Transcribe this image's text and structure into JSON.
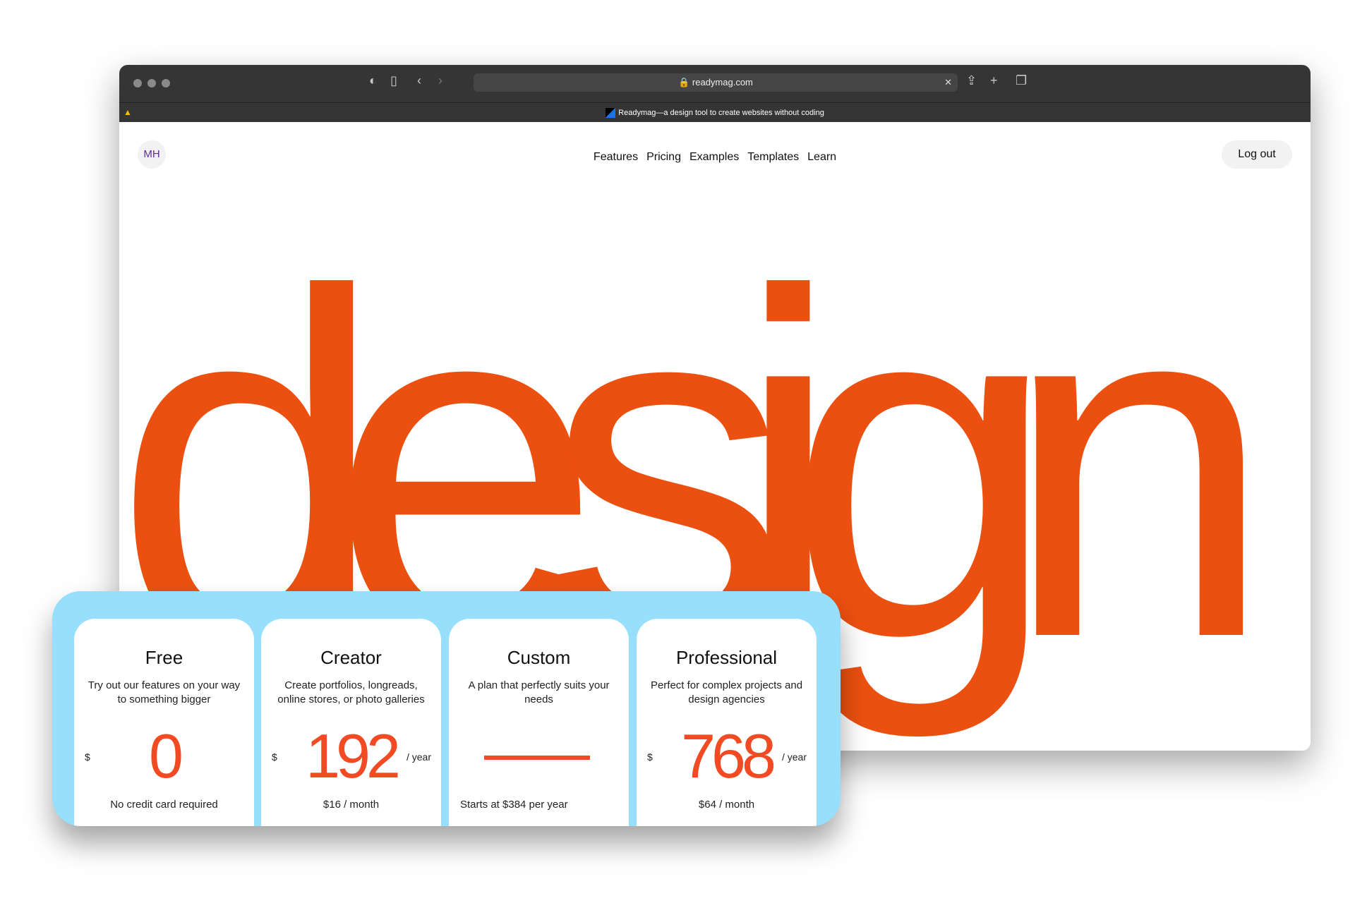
{
  "browser": {
    "url": "readymag.com",
    "tab_title": "Readymag—a design tool to create websites without coding"
  },
  "site": {
    "avatar": "MH",
    "nav": [
      "Features",
      "Pricing",
      "Examples",
      "Templates",
      "Learn"
    ],
    "logout": "Log out",
    "hero": "design",
    "accent": "#ec5010"
  },
  "plans": [
    {
      "name": "Free",
      "desc": "Try out our features on your way to something bigger",
      "currency": "$",
      "price": "0",
      "period": "",
      "note": "No credit card required"
    },
    {
      "name": "Creator",
      "desc": "Create portfolios, longreads, online stores, or photo galleries",
      "currency": "$",
      "price": "192",
      "period": "/ year",
      "note": "$16 / month"
    },
    {
      "name": "Custom",
      "desc": "A plan that perfectly suits your needs",
      "currency": "",
      "price": "",
      "period": "",
      "note": "Starts at $384 per year"
    },
    {
      "name": "Professional",
      "desc": "Perfect for complex projects and design agencies",
      "currency": "$",
      "price": "768",
      "period": "/ year",
      "note": "$64 / month"
    }
  ]
}
